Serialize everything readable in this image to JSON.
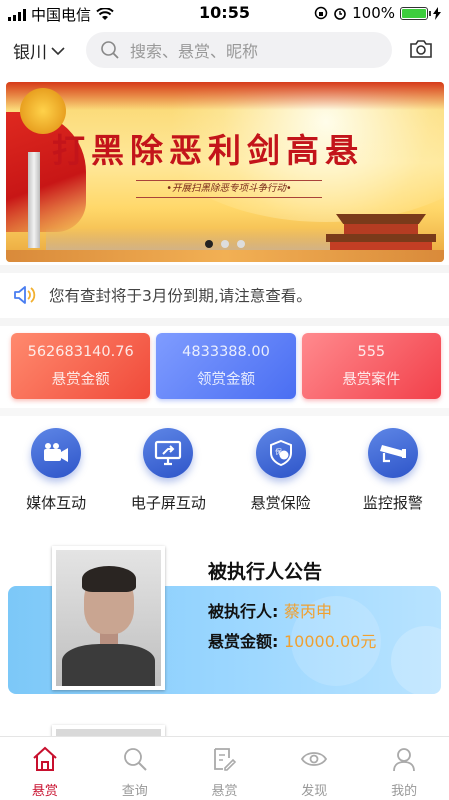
{
  "status_bar": {
    "carrier": "中国电信",
    "time": "10:55",
    "battery": "100%"
  },
  "header": {
    "city": "银川",
    "search_placeholder": "搜索、悬赏、昵称"
  },
  "banner": {
    "title": "打黑除恶利剑高悬",
    "subtitle": "•开展扫黑除恶专项斗争行动•",
    "active_dot": 0,
    "dot_count": 3
  },
  "notice": {
    "text": "您有查封将于3月份到期,请注意查看。"
  },
  "stats": [
    {
      "value": "562683140.76",
      "label": "悬赏金额",
      "color": "#f04a3a"
    },
    {
      "value": "4833388.00",
      "label": "领赏金额",
      "color": "#4a6ef2"
    },
    {
      "value": "555",
      "label": "悬赏案件",
      "color": "#f2404a"
    }
  ],
  "features": [
    {
      "label": "媒体互动",
      "icon": "video-camera-icon"
    },
    {
      "label": "电子屏互动",
      "icon": "screen-share-icon"
    },
    {
      "label": "悬赏保险",
      "icon": "shield-insurance-icon"
    },
    {
      "label": "监控报警",
      "icon": "cctv-camera-icon"
    }
  ],
  "announcement": {
    "title": "被执行人公告",
    "person_label": "被执行人:",
    "person_value": "蔡丙申",
    "amount_label": "悬赏金额:",
    "amount_value": "10000.00元"
  },
  "tabs": [
    {
      "label": "悬赏",
      "icon": "home-icon",
      "active": true
    },
    {
      "label": "查询",
      "icon": "search-icon",
      "active": false
    },
    {
      "label": "悬赏",
      "icon": "edit-note-icon",
      "active": false
    },
    {
      "label": "发现",
      "icon": "eye-icon",
      "active": false
    },
    {
      "label": "我的",
      "icon": "user-icon",
      "active": false
    }
  ],
  "colors": {
    "accent": "#c8102e",
    "highlight": "#f0a030"
  }
}
